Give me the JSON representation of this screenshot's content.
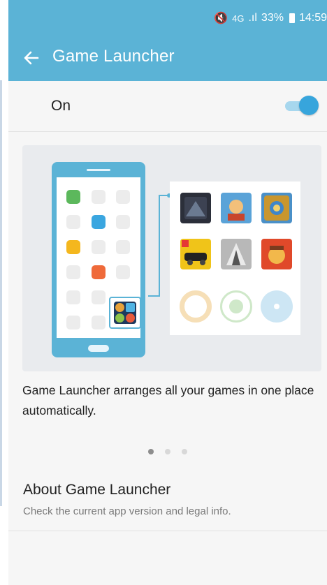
{
  "status_bar": {
    "network": "4G",
    "battery": "33%",
    "time": "14:59"
  },
  "app_bar": {
    "title": "Game Launcher"
  },
  "toggle": {
    "label": "On",
    "state": "on",
    "accent_color": "#37a5dc"
  },
  "illustration": {
    "games": [
      {
        "name": "star-wars-game-icon",
        "color": "#2b2f3a"
      },
      {
        "name": "kings-game-icon",
        "color": "#5aa3d8"
      },
      {
        "name": "hearthstone-game-icon",
        "color": "#4a90c8"
      },
      {
        "name": "asphalt-game-icon",
        "color": "#f0c419"
      },
      {
        "name": "assassins-creed-game-icon",
        "color": "#b8b8b8"
      },
      {
        "name": "clash-of-clans-game-icon",
        "color": "#e0492a"
      }
    ]
  },
  "description": "Game Launcher arranges all your games in one place automatically.",
  "pager": {
    "count": 3,
    "active_index": 0
  },
  "about": {
    "title": "About Game Launcher",
    "subtitle": "Check the current app version and legal info."
  },
  "colors": {
    "primary": "#5bb3d6"
  }
}
